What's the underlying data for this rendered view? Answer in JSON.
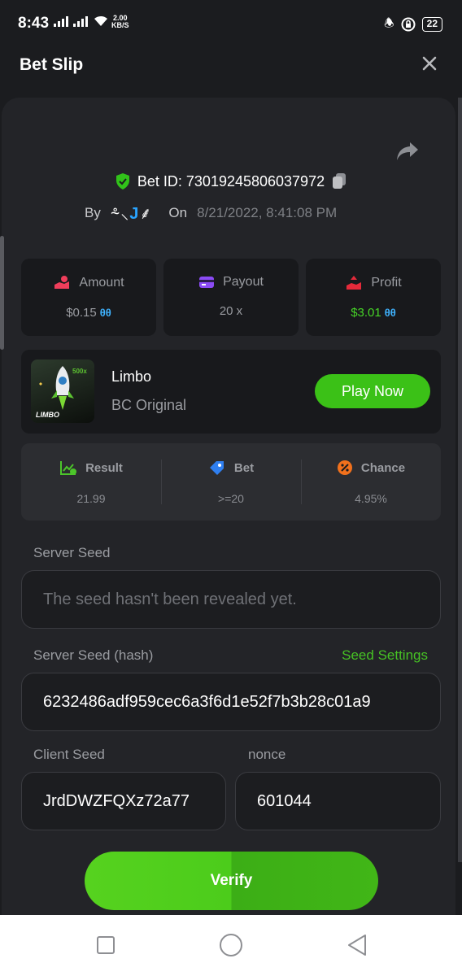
{
  "status_bar": {
    "time": "8:43",
    "speed_value": "2.00",
    "speed_unit": "KB/S",
    "battery": "22"
  },
  "header": {
    "title": "Bet Slip"
  },
  "bet": {
    "id_label": "Bet ID: 73019245806037972",
    "by_label": "By",
    "username_prefix": "⸛⸜",
    "username_j": "J",
    "username_suffix": "⸙",
    "on_label": "On",
    "date": "8/21/2022, 8:41:08 PM"
  },
  "stats": [
    {
      "label": "Amount",
      "value": "$0.15",
      "coin": "θθ",
      "color": "#9a9ca1"
    },
    {
      "label": "Payout",
      "value": "20 x",
      "coin": "",
      "color": "#9a9ca1"
    },
    {
      "label": "Profit",
      "value": "$3.01",
      "coin": "θθ",
      "color": "#46d327"
    }
  ],
  "game": {
    "name": "Limbo",
    "subtitle": "BC Original",
    "thumb_multiplier": "500x",
    "thumb_label": "LIMBO",
    "play_label": "Play Now"
  },
  "result": [
    {
      "label": "Result",
      "value": "21.99"
    },
    {
      "label": "Bet",
      "value": ">=20"
    },
    {
      "label": "Chance",
      "value": "4.95%"
    }
  ],
  "seeds": {
    "server_seed_label": "Server Seed",
    "server_seed_placeholder": "The seed hasn't been revealed yet.",
    "server_hash_label": "Server Seed (hash)",
    "seed_settings_label": "Seed Settings",
    "server_hash_value": "6232486adf959cec6a3f6d1e52f7b3b28c01a9",
    "client_seed_label": "Client Seed",
    "client_seed_value": "JrdDWZFQXz72a77",
    "nonce_label": "nonce",
    "nonce_value": "601044"
  },
  "verify_label": "Verify",
  "colors": {
    "accent_green": "#46c224",
    "background": "#1b1c1f",
    "card": "#18191c"
  }
}
